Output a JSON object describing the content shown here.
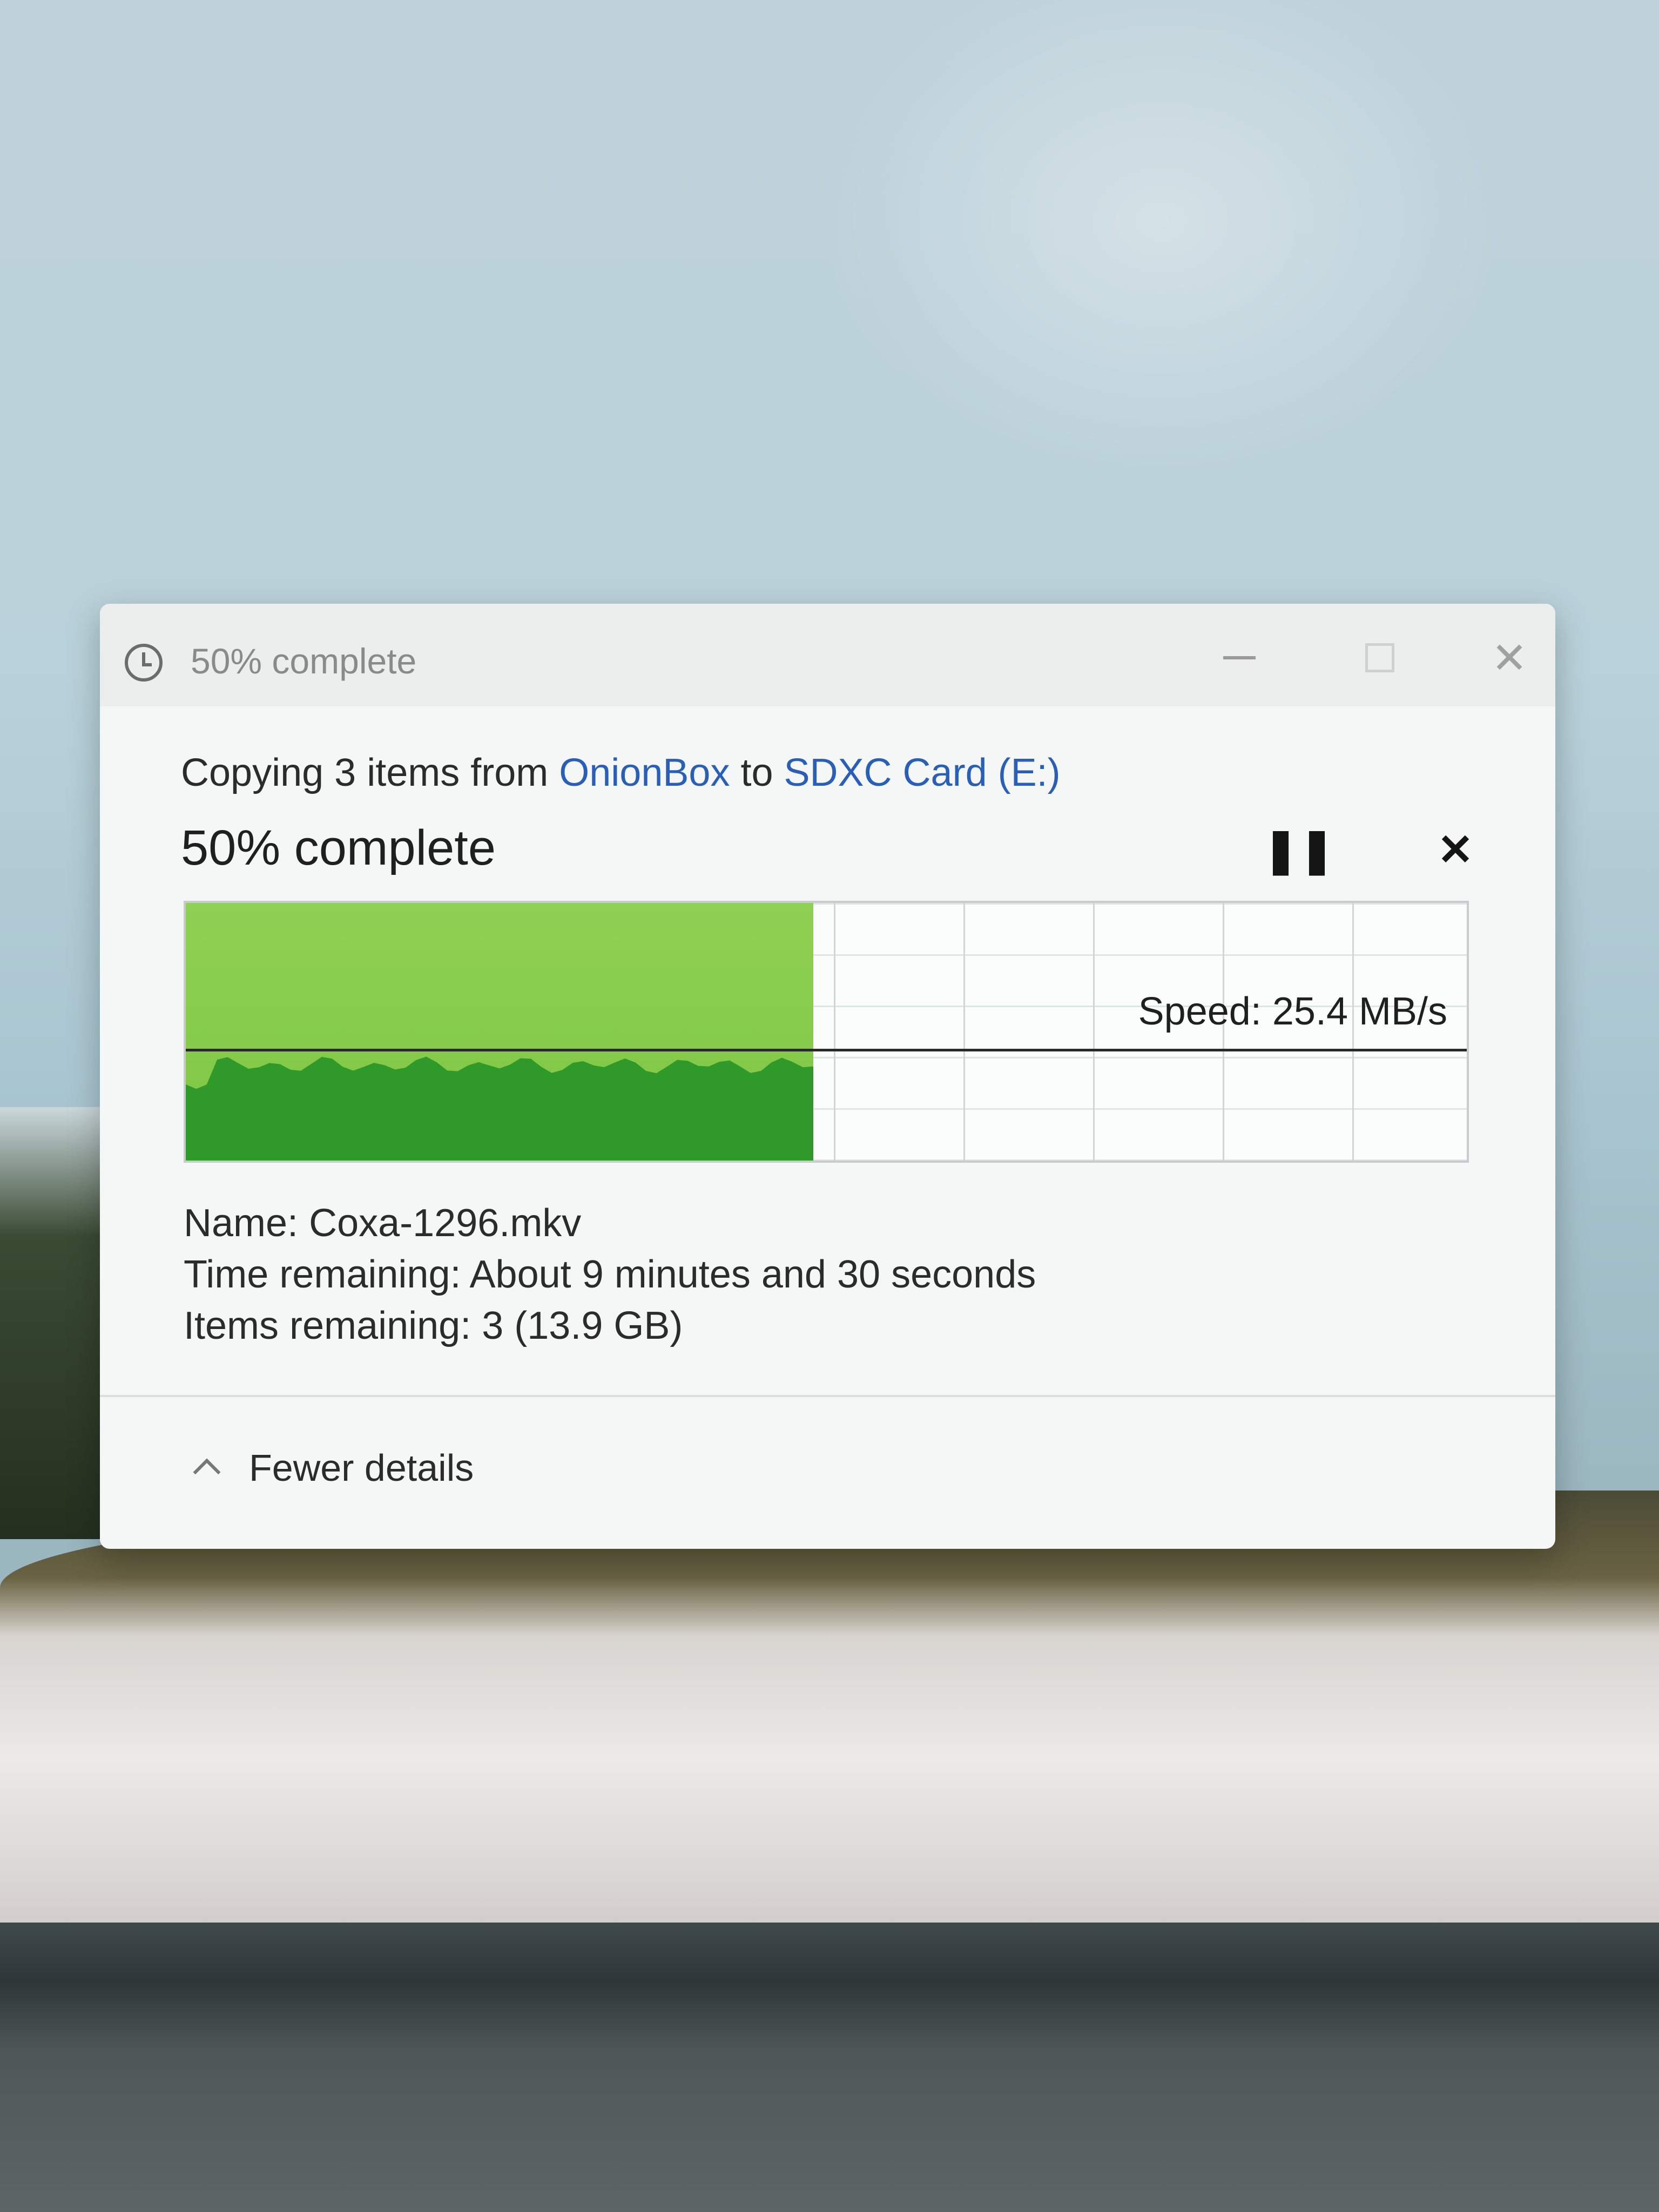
{
  "window": {
    "title": "50% complete"
  },
  "dialog": {
    "copy_prefix": "Copying 3 items from ",
    "source": "OnionBox",
    "copy_mid": " to ",
    "destination": "SDXC Card (E:)",
    "percent_label": "50% complete",
    "progress_percent": 50
  },
  "graph": {
    "speed_label": "Speed: 25.4 MB/s"
  },
  "details": {
    "name_label": "Name:",
    "name_value": "Coxa-1296.mkv",
    "time_label": "Time remaining:",
    "time_value": "About 9 minutes and 30 seconds",
    "items_label": "Items remaining:",
    "items_value": "3 (13.9 GB)"
  },
  "footer": {
    "fewer_details": "Fewer details"
  },
  "colors": {
    "fill_light": "#8fd154",
    "fill_dark": "#2f9a2a",
    "link": "#2a5fb8"
  },
  "icons": [
    "clock-icon",
    "minimize-icon",
    "maximize-icon",
    "close-icon",
    "pause-icon",
    "cancel-icon",
    "chevron-up-icon"
  ]
}
